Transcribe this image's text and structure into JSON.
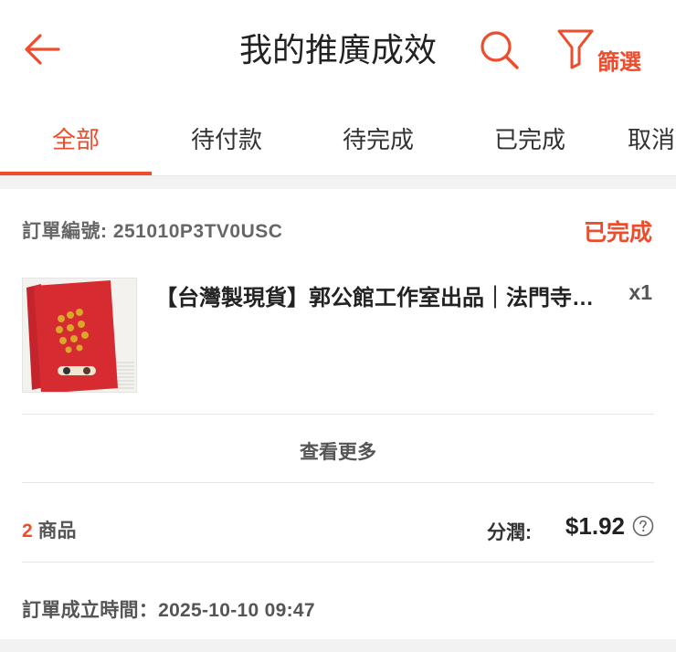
{
  "header": {
    "title": "我的推廣成效",
    "filter_label": "篩選",
    "back_icon": "arrow-left-icon",
    "search_icon": "search-icon",
    "filter_icon": "funnel-icon"
  },
  "tabs": [
    {
      "label": "全部",
      "active": true
    },
    {
      "label": "待付款",
      "active": false
    },
    {
      "label": "待完成",
      "active": false
    },
    {
      "label": "已完成",
      "active": false
    },
    {
      "label": "取消",
      "active": false
    }
  ],
  "order": {
    "order_no": "訂單編號: 251010P3TV0USC",
    "status": "已完成",
    "product": {
      "name": "【台灣製現貨】郭公館工作室出品｜法門寺紅包",
      "quantity": "x1"
    },
    "view_more": "查看更多",
    "items_count_num": "2",
    "items_count_label": " 商品",
    "commission_label": "分潤:",
    "commission_value": "$1.92",
    "created_at": "訂單成立時間：2025-10-10 09:47"
  },
  "colors": {
    "accent": "#ee4d2d",
    "background": "#f2f2f2",
    "card": "#ffffff"
  }
}
